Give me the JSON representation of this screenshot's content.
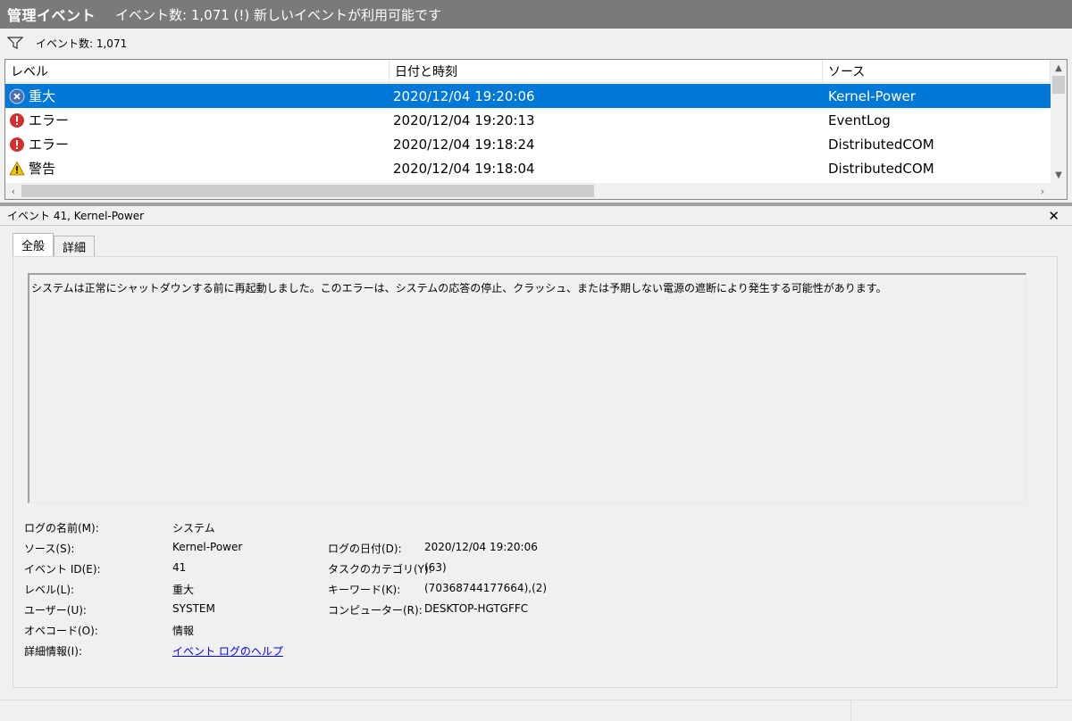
{
  "title": {
    "main": "管理イベント",
    "sub": "イベント数: 1,071 (!) 新しいイベントが利用可能です"
  },
  "filter": {
    "icon": "filter-icon",
    "label": "イベント数: 1,071"
  },
  "list": {
    "columns": [
      "レベル",
      "日付と時刻",
      "ソース"
    ],
    "rows": [
      {
        "level": "重大",
        "icon": "critical-icon",
        "datetime": "2020/12/04 19:20:06",
        "source": "Kernel-Power",
        "selected": true
      },
      {
        "level": "エラー",
        "icon": "error-icon",
        "datetime": "2020/12/04 19:20:13",
        "source": "EventLog",
        "selected": false
      },
      {
        "level": "エラー",
        "icon": "error-icon",
        "datetime": "2020/12/04 19:18:24",
        "source": "DistributedCOM",
        "selected": false
      },
      {
        "level": "警告",
        "icon": "warning-icon",
        "datetime": "2020/12/04 19:18:04",
        "source": "DistributedCOM",
        "selected": false
      }
    ]
  },
  "detail": {
    "title": "イベント 41, Kernel-Power",
    "close": "✕",
    "tabs": [
      "全般",
      "詳細"
    ],
    "description": "システムは正常にシャットダウンする前に再起動しました。このエラーは、システムの応答の停止、クラッシュ、または予期しない電源の遮断により発生する可能性があります。",
    "props": {
      "log_name_label": "ログの名前(M):",
      "log_name": "システム",
      "source_label": "ソース(S):",
      "source": "Kernel-Power",
      "logged_label": "ログの日付(D):",
      "logged": "2020/12/04 19:20:06",
      "event_id_label": "イベント ID(E):",
      "event_id": "41",
      "task_label": "タスクのカテゴリ(Y):",
      "task": "(63)",
      "level_label": "レベル(L):",
      "level": "重大",
      "keywords_label": "キーワード(K):",
      "keywords": "(70368744177664),(2)",
      "user_label": "ユーザー(U):",
      "user": "SYSTEM",
      "computer_label": "コンピューター(R):",
      "computer": "DESKTOP-HGTGFFC",
      "opcode_label": "オペコード(O):",
      "opcode": "情報",
      "more_info_label": "詳細情報(I):",
      "more_info_link": "イベント ログのヘルプ"
    }
  },
  "colors": {
    "selection": "#0078d7",
    "titlebar": "#7a7a7a",
    "link": "#0000ee"
  }
}
